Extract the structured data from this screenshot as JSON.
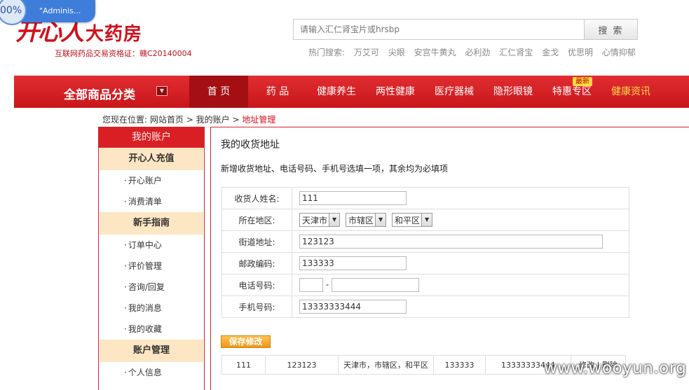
{
  "overlay": {
    "percent": "00%",
    "admin_label": "\"Adminis..."
  },
  "logo": {
    "brand": "开心人",
    "brand_suffix": "大药房",
    "license": "互联网药品交易资格证：赣C20140004"
  },
  "search": {
    "placeholder": "请输入汇仁肾宝片或hrsbp",
    "button": "搜 索"
  },
  "hot": {
    "label": "热门搜索:",
    "items": [
      "万艾可",
      "尖眼",
      "安宫牛黄丸",
      "必利劲",
      "汇仁肾宝",
      "金戈",
      "优思明",
      "心情抑郁"
    ]
  },
  "nav": {
    "all_label": "全部商品分类",
    "items": [
      "首 页",
      "药 品",
      "健康养生",
      "两性健康",
      "医疗器械",
      "隐形眼镜",
      "特惠专区",
      "健康资讯"
    ],
    "new_tag": "最新"
  },
  "breadcrumb": {
    "prefix": "您现在位置:",
    "home": "网站首页",
    "sep1": ">",
    "account": "我的账户",
    "sep2": ">",
    "current": "地址管理"
  },
  "sidebar": {
    "title": "我的账户",
    "sections": [
      {
        "title": "开心人充值",
        "items": [
          "开心账户",
          "消费清单"
        ]
      },
      {
        "title": "新手指南",
        "items": [
          "订单中心",
          "评价管理",
          "咨询/回复",
          "我的消息",
          "我的收藏"
        ]
      },
      {
        "title": "账户管理",
        "items": [
          "个人信息"
        ]
      }
    ]
  },
  "main": {
    "title": "我的收货地址",
    "note": "新增收货地址、电话号码、手机号选填一项，其余均为必填项",
    "labels": {
      "name": "收货人姓名:",
      "region": "所在地区:",
      "street": "街道地址:",
      "zip": "邮政编码:",
      "phone": "电话号码:",
      "mobile": "手机号码:"
    },
    "values": {
      "name": "111",
      "province": "天津市",
      "city": "市辖区",
      "district": "和平区",
      "street": "123123",
      "zip": "133333",
      "phone_area": "",
      "phone_dash": "-",
      "phone_num": "",
      "mobile": "13333333444"
    },
    "save_button": "保存修改",
    "address_row": {
      "name": "111",
      "street": "123123",
      "region": "天津市，市辖区，和平区",
      "zip": "133333",
      "mobile": "13333333444",
      "edit": "修改",
      "sep": "|",
      "delete": "删除"
    }
  },
  "watermark": "www.wooyun.org"
}
